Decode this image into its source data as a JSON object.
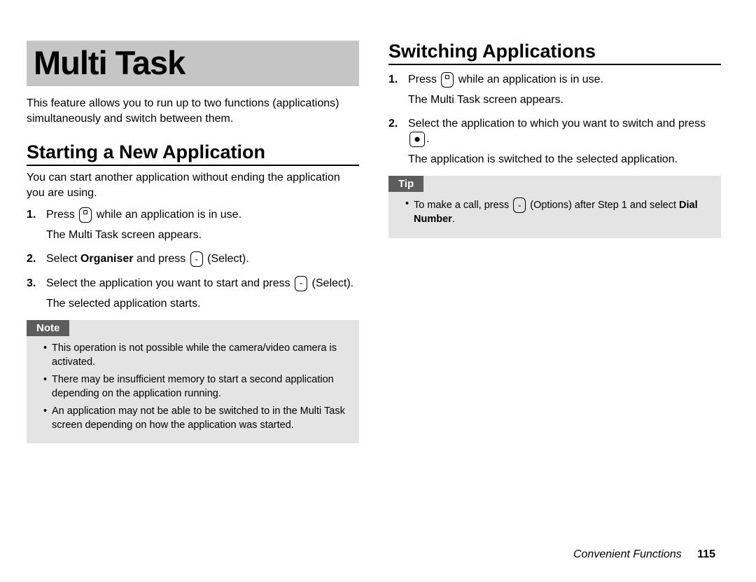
{
  "left": {
    "chapter_title": "Multi Task",
    "intro": "This feature allows you to run up to two functions (applications) simultaneously and switch between them.",
    "section_heading": "Starting a New Application",
    "subintro": "You can start another application without ending the application you are using.",
    "step1_a": "Press ",
    "step1_b": " while an application is in use.",
    "step1_note": "The Multi Task screen appears.",
    "step2_a": "Select ",
    "step2_bold": "Organiser",
    "step2_b": " and press ",
    "step2_c": " (Select).",
    "step3_a": "Select the application you want to start and press ",
    "step3_b": " (Select).",
    "step3_note": "The selected application starts.",
    "note_label": "Note",
    "note_1": "This operation is not possible while the camera/video camera is activated.",
    "note_2": "There may be insufficient memory to start a second application depending on the application running.",
    "note_3": "An application may not be able to be switched to in the Multi Task screen depending on how the application was started."
  },
  "right": {
    "section_heading": "Switching Applications",
    "step1_a": "Press ",
    "step1_b": " while an application is in use.",
    "step1_note": "The Multi Task screen appears.",
    "step2_a": "Select the application to which you want to switch and press ",
    "step2_b": ".",
    "step2_note": "The application is switched to the selected application.",
    "tip_label": "Tip",
    "tip1_a": "To make a call, press ",
    "tip1_b": " (Options) after Step 1 and select ",
    "tip1_bold": "Dial Number",
    "tip1_c": "."
  },
  "footer": {
    "chapter": "Convenient Functions",
    "page": "115"
  }
}
